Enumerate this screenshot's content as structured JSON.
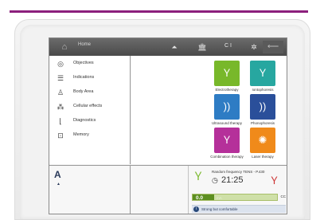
{
  "topbar": {
    "home_label": "Home",
    "language_label": "C I",
    "icons": [
      "home-icon",
      "gear-icon",
      "building-icon",
      "back-arrow-icon"
    ]
  },
  "menu": {
    "items": [
      {
        "label": "Objectives",
        "icon": "target-icon"
      },
      {
        "label": "Indications",
        "icon": "list-icon"
      },
      {
        "label": "Body Area",
        "icon": "body-icon"
      },
      {
        "label": "Cellular effects",
        "icon": "cells-icon"
      },
      {
        "label": "Diagnostics",
        "icon": "diagnostics-curve-icon"
      },
      {
        "label": "Memory",
        "icon": "memory-icon"
      }
    ]
  },
  "therapies": [
    {
      "label": "Electrotherapy",
      "color": "#78b82a",
      "icon": "electrode-icon"
    },
    {
      "label": "Iontophoresis",
      "color": "#27a7a0",
      "icon": "iontophoresis-icon"
    },
    {
      "label": "Ultrasound therapy",
      "color": "#2e7cc4",
      "icon": "ultrasound-icon"
    },
    {
      "label": "Phonophoresis",
      "color": "#2a4f9a",
      "icon": "phonophoresis-icon"
    },
    {
      "label": "Combination therapy",
      "color": "#b5309a",
      "icon": "combination-icon"
    },
    {
      "label": "Laser therapy",
      "color": "#f08a1a",
      "icon": "laser-icon"
    }
  ],
  "channel": {
    "letter": "A",
    "caret": "▲"
  },
  "treatment": {
    "program": "Random frequency TENS - P.430",
    "timer": "21:25",
    "intensity_value": "0.0",
    "intensity_unit": "mA",
    "intensity_level": 0.25,
    "mode": "CC",
    "status_text": "Strong but comfortable"
  }
}
